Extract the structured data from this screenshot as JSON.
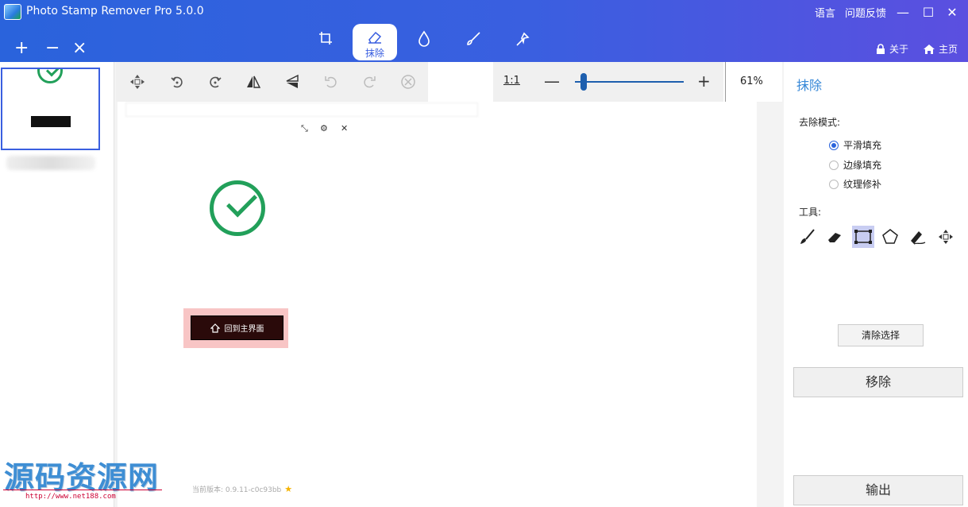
{
  "app": {
    "title": "Photo Stamp Remover Pro 5.0.0",
    "language_label": "语言",
    "feedback_label": "问题反馈",
    "about_label": "关于",
    "home_label": "主页",
    "accent_color": "#3a5fe0"
  },
  "left_actions": {
    "add": "+",
    "remove": "−",
    "close": "×"
  },
  "mode_tabs": [
    {
      "icon": "crop-icon",
      "label": ""
    },
    {
      "icon": "eraser-icon",
      "label": "抹除",
      "active": true
    },
    {
      "icon": "drop-icon",
      "label": ""
    },
    {
      "icon": "brush-icon",
      "label": ""
    },
    {
      "icon": "wand-icon",
      "label": ""
    }
  ],
  "thumbnails": [
    {
      "selected": true
    }
  ],
  "toolbar": {
    "zoom_one_to_one": "1:1",
    "zoom_percent": "61%",
    "zoom_level": 0.08
  },
  "canvas": {
    "home_button_label": "回到主界面",
    "version_text": "当前版本: 0.9.11-c0c93bb"
  },
  "right_panel": {
    "title": "抹除",
    "mode_label": "去除模式:",
    "modes": [
      {
        "label": "平滑填充",
        "checked": true
      },
      {
        "label": "边缘填充",
        "checked": false
      },
      {
        "label": "纹理修补",
        "checked": false
      }
    ],
    "tools_label": "工具:",
    "tools": [
      "brush-icon",
      "eraser-icon",
      "rectangle-icon",
      "polygon-icon",
      "magic-pen-icon",
      "move-icon"
    ],
    "active_tool": "rectangle-icon",
    "clear_selection": "清除选择",
    "remove": "移除",
    "export": "输出"
  },
  "watermark": {
    "text": "源码资源网",
    "url": "http://www.net188.com"
  }
}
